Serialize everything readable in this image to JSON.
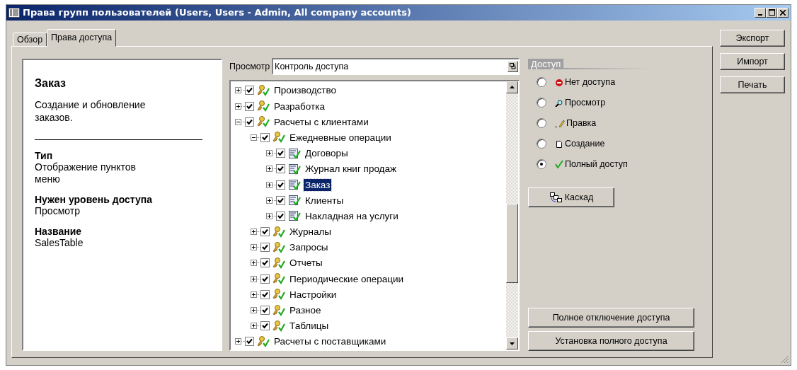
{
  "window": {
    "title": "Права групп пользователей (Users, Users - Admin, All company accounts)"
  },
  "tabs": [
    {
      "label": "Обзор",
      "selected": false
    },
    {
      "label": "Права доступа",
      "selected": true
    }
  ],
  "info": {
    "title": "Заказ",
    "description": "Создание и обновление заказов.",
    "fields": [
      {
        "label": "Тип",
        "value": "Отображение пунктов меню"
      },
      {
        "label": "Нужен уровень доступа",
        "value": "Просмотр"
      },
      {
        "label": "Название",
        "value": "SalesTable"
      }
    ]
  },
  "view": {
    "label": "Просмотр",
    "value": "Контроль доступа"
  },
  "tree": {
    "items": [
      {
        "label": "Производство",
        "kind": "module",
        "checked": true,
        "expanded": false,
        "selected": false
      },
      {
        "label": "Разработка",
        "kind": "module",
        "checked": true,
        "expanded": false,
        "selected": false
      },
      {
        "label": "Расчеты с клиентами",
        "kind": "module",
        "checked": true,
        "expanded": true,
        "selected": false,
        "children": [
          {
            "label": "Ежедневные операции",
            "kind": "module",
            "checked": true,
            "expanded": true,
            "selected": false,
            "children": [
              {
                "label": "Договоры",
                "kind": "form",
                "checked": true,
                "expanded": false,
                "selected": false
              },
              {
                "label": "Журнал книг продаж",
                "kind": "form",
                "checked": true,
                "expanded": false,
                "selected": false
              },
              {
                "label": "Заказ",
                "kind": "form",
                "checked": true,
                "expanded": false,
                "selected": true
              },
              {
                "label": "Клиенты",
                "kind": "form",
                "checked": true,
                "expanded": false,
                "selected": false
              },
              {
                "label": "Накладная на услуги",
                "kind": "form",
                "checked": true,
                "expanded": false,
                "selected": false
              }
            ]
          },
          {
            "label": "Журналы",
            "kind": "module",
            "checked": true,
            "expanded": false,
            "selected": false
          },
          {
            "label": "Запросы",
            "kind": "module",
            "checked": true,
            "expanded": false,
            "selected": false
          },
          {
            "label": "Отчеты",
            "kind": "module",
            "checked": true,
            "expanded": false,
            "selected": false
          },
          {
            "label": "Периодические операции",
            "kind": "module",
            "checked": true,
            "expanded": false,
            "selected": false
          },
          {
            "label": "Настройки",
            "kind": "module",
            "checked": true,
            "expanded": false,
            "selected": false
          },
          {
            "label": "Разное",
            "kind": "module",
            "checked": true,
            "expanded": false,
            "selected": false
          },
          {
            "label": "Таблицы",
            "kind": "module",
            "checked": true,
            "expanded": false,
            "selected": false
          }
        ]
      },
      {
        "label": "Расчеты с поставщиками",
        "kind": "module",
        "checked": true,
        "expanded": false,
        "selected": false
      }
    ]
  },
  "access": {
    "title": "Доступ",
    "options": [
      {
        "label": "Нет доступа",
        "kind": "none",
        "selected": false
      },
      {
        "label": "Просмотр",
        "kind": "view",
        "selected": false
      },
      {
        "label": "Правка",
        "kind": "edit",
        "selected": false
      },
      {
        "label": "Создание",
        "kind": "create",
        "selected": false
      },
      {
        "label": "Полный доступ",
        "kind": "full",
        "selected": true
      }
    ],
    "cascade_button": "Каскад",
    "buttons": [
      "Полное отключение доступа",
      "Установка полного доступа"
    ]
  },
  "side_buttons": [
    "Экспорт",
    "Импорт",
    "Печать"
  ]
}
